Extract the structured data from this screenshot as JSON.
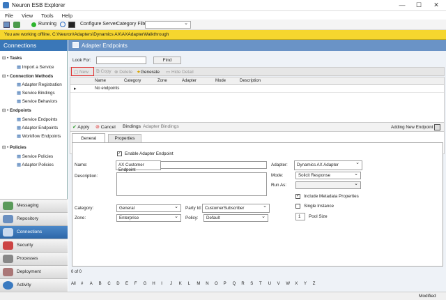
{
  "window": {
    "title": "Neuron ESB Explorer",
    "minimize": "—",
    "maximize": "☐",
    "close": "✕"
  },
  "menu": {
    "file": "File",
    "view": "View",
    "tools": "Tools",
    "help": "Help"
  },
  "toolbar": {
    "running": "Running",
    "configure_server": "Configure Server",
    "category_filter": "Category Filter"
  },
  "offline_message": "You are working offline. C:\\Neuron\\Adapters\\Dynamics AX\\AXAdapterWalkthrough",
  "sidebar": {
    "title": "Connections",
    "groups": [
      {
        "label": "Tasks",
        "items": [
          "Import a Service"
        ]
      },
      {
        "label": "Connection Methods",
        "items": [
          "Adapter Registration",
          "Service Bindings",
          "Service Behaviors"
        ]
      },
      {
        "label": "Endpoints",
        "items": [
          "Service Endpoints",
          "Adapter Endpoints",
          "Workflow Endpoints"
        ]
      },
      {
        "label": "Policies",
        "items": [
          "Service Policies",
          "Adapter Policies"
        ]
      }
    ],
    "nav": [
      "Messaging",
      "Repository",
      "Connections",
      "Security",
      "Processes",
      "Deployment",
      "Activity"
    ]
  },
  "panel": {
    "title": "Adapter Endpoints",
    "look_for_label": "Look For:",
    "look_for_value": "",
    "find": "Find",
    "actions": {
      "new": "New",
      "copy": "Copy",
      "delete": "Delete",
      "generate": "Generate",
      "hide_detail": "Hide Detail"
    },
    "columns": [
      "Name",
      "Category",
      "Zone",
      "Adapter",
      "Mode",
      "Description"
    ],
    "empty_row": "No endpoints"
  },
  "detail": {
    "apply": "Apply",
    "cancel": "Cancel",
    "bindings": "Bindings",
    "adapter_bindings": "Adapter Bindings",
    "status": "Adding New Endpoint",
    "tabs": [
      "General",
      "Properties"
    ],
    "enable_label": "Enable Adapter Endpoint",
    "name_label": "Name:",
    "name_value": "AX Customer Endpoint",
    "description_label": "Description:",
    "category_label": "Category:",
    "category_value": "General",
    "zone_label": "Zone:",
    "zone_value": "Enterprise",
    "partyid_label": "Party Id:",
    "partyid_value": "CustomerSubscriber",
    "policy_label": "Policy:",
    "policy_value": "Default",
    "adapter_label": "Adapter:",
    "adapter_value": "Dynamics AX Adapter",
    "mode_label": "Mode:",
    "mode_value": "Solicit Response",
    "runas_label": "Run As:",
    "runas_value": "",
    "include_metadata": "Include Metadata Properties",
    "single_instance": "Single Instance",
    "pool_size_value": "1",
    "pool_size_label": "Pool Size"
  },
  "pager": "0 of 0",
  "alpha": [
    "All",
    "#",
    "A",
    "B",
    "C",
    "D",
    "E",
    "F",
    "G",
    "H",
    "I",
    "J",
    "K",
    "L",
    "M",
    "N",
    "O",
    "P",
    "Q",
    "R",
    "S",
    "T",
    "U",
    "V",
    "W",
    "X",
    "Y",
    "Z"
  ],
  "statusbar": "Modified"
}
